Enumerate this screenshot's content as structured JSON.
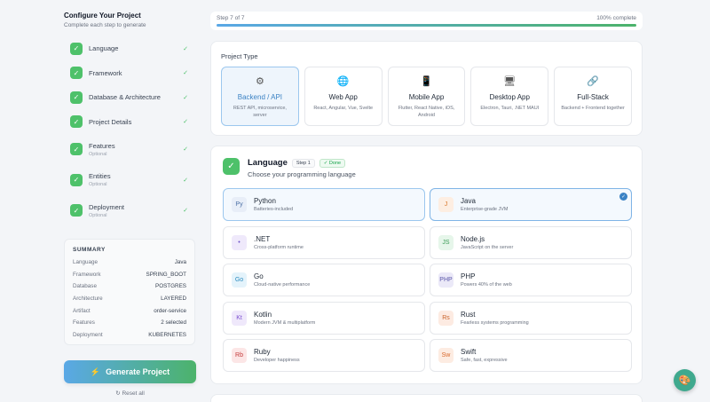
{
  "sidebar": {
    "title": "Configure Your Project",
    "subtitle": "Complete each step to generate",
    "steps": [
      {
        "label": "Language",
        "optional": ""
      },
      {
        "label": "Framework",
        "optional": ""
      },
      {
        "label": "Database & Architecture",
        "optional": ""
      },
      {
        "label": "Project Details",
        "optional": ""
      },
      {
        "label": "Features",
        "optional": "Optional"
      },
      {
        "label": "Entities",
        "optional": "Optional"
      },
      {
        "label": "Deployment",
        "optional": "Optional"
      }
    ],
    "summary": {
      "title": "SUMMARY",
      "rows": [
        {
          "key": "Language",
          "value": "Java"
        },
        {
          "key": "Framework",
          "value": "SPRING_BOOT"
        },
        {
          "key": "Database",
          "value": "POSTGRES"
        },
        {
          "key": "Architecture",
          "value": "LAYERED"
        },
        {
          "key": "Artifact",
          "value": "order-service"
        },
        {
          "key": "Features",
          "value": "2 selected"
        },
        {
          "key": "Deployment",
          "value": "KUBERNETES"
        }
      ]
    },
    "generate_label": "Generate Project",
    "reset_label": "Reset all"
  },
  "progress": {
    "step_text": "Step 7 of 7",
    "complete_text": "100% complete",
    "fraction": 1.0
  },
  "project_type": {
    "title": "Project Type",
    "options": [
      {
        "name": "Backend / API",
        "desc": "REST API, microservice, server",
        "icon": "gear-icon",
        "selected": true
      },
      {
        "name": "Web App",
        "desc": "React, Angular, Vue, Svelte",
        "icon": "globe-icon",
        "selected": false
      },
      {
        "name": "Mobile App",
        "desc": "Flutter, React Native, iOS, Android",
        "icon": "phone-icon",
        "selected": false
      },
      {
        "name": "Desktop App",
        "desc": "Electron, Tauri, .NET MAUI",
        "icon": "monitor-icon",
        "selected": false
      },
      {
        "name": "Full-Stack",
        "desc": "Backend + Frontend together",
        "icon": "link-icon",
        "selected": false
      }
    ]
  },
  "language": {
    "title": "Language",
    "step_badge": "Step 1",
    "done_badge": "✓ Done",
    "subtitle": "Choose your programming language",
    "options": [
      {
        "abbr": "Py",
        "name": "Python",
        "desc": "Batteries-included",
        "bg": "#e8eef8",
        "fg": "#4a6fa5"
      },
      {
        "abbr": "J",
        "name": "Java",
        "desc": "Enterprise-grade JVM",
        "bg": "#fdeee2",
        "fg": "#d9772b"
      },
      {
        "abbr": "•",
        "name": ".NET",
        "desc": "Cross-platform runtime",
        "bg": "#efe9fb",
        "fg": "#6b4fc7"
      },
      {
        "abbr": "JS",
        "name": "Node.js",
        "desc": "JavaScript on the server",
        "bg": "#e6f6ea",
        "fg": "#3a9b55"
      },
      {
        "abbr": "Go",
        "name": "Go",
        "desc": "Cloud-native performance",
        "bg": "#e4f3fb",
        "fg": "#2a8bbf"
      },
      {
        "abbr": "PHP",
        "name": "PHP",
        "desc": "Powers 40% of the web",
        "bg": "#ebe9f8",
        "fg": "#5a56a8"
      },
      {
        "abbr": "Kt",
        "name": "Kotlin",
        "desc": "Modern JVM & multiplatform",
        "bg": "#efe8fb",
        "fg": "#7b4fd0"
      },
      {
        "abbr": "Rs",
        "name": "Rust",
        "desc": "Fearless systems programming",
        "bg": "#fdebe2",
        "fg": "#c9622a"
      },
      {
        "abbr": "Rb",
        "name": "Ruby",
        "desc": "Developer happiness",
        "bg": "#fce6e6",
        "fg": "#c43b3b"
      },
      {
        "abbr": "Sw",
        "name": "Swift",
        "desc": "Safe, fast, expressive",
        "bg": "#fdece2",
        "fg": "#d9682b"
      }
    ]
  },
  "colors": {
    "accent": "#3b82c4",
    "success": "#4ec16a",
    "fab": "#3fa98e"
  }
}
